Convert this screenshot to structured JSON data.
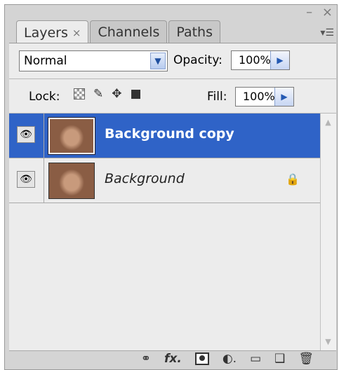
{
  "tabs": [
    {
      "label": "Layers",
      "active": true,
      "close": "×"
    },
    {
      "label": "Channels",
      "active": false
    },
    {
      "label": "Paths",
      "active": false
    }
  ],
  "blend_mode": {
    "value": "Normal"
  },
  "opacity": {
    "label": "Opacity:",
    "value": "100%"
  },
  "lock": {
    "label": "Lock:"
  },
  "fill": {
    "label": "Fill:",
    "value": "100%"
  },
  "layers": [
    {
      "name": "Background copy",
      "selected": true,
      "visible": true
    },
    {
      "name": "Background",
      "selected": false,
      "visible": true,
      "locked": true
    }
  ],
  "colors": {
    "selection": "#2f63c7",
    "panel": "#d4d4d4",
    "list": "#ececec"
  },
  "icons": {
    "eye": "eye-icon",
    "lock_transparent": "lock-transparent-icon",
    "lock_pixels": "lock-pixels-icon",
    "lock_position": "lock-position-icon",
    "lock_all": "lock-all-icon",
    "link": "link-icon",
    "fx": "fx-icon",
    "mask": "mask-icon",
    "adjustment": "adjustment-icon",
    "group": "folder-icon",
    "new_layer": "new-layer-icon",
    "delete": "trash-icon"
  }
}
